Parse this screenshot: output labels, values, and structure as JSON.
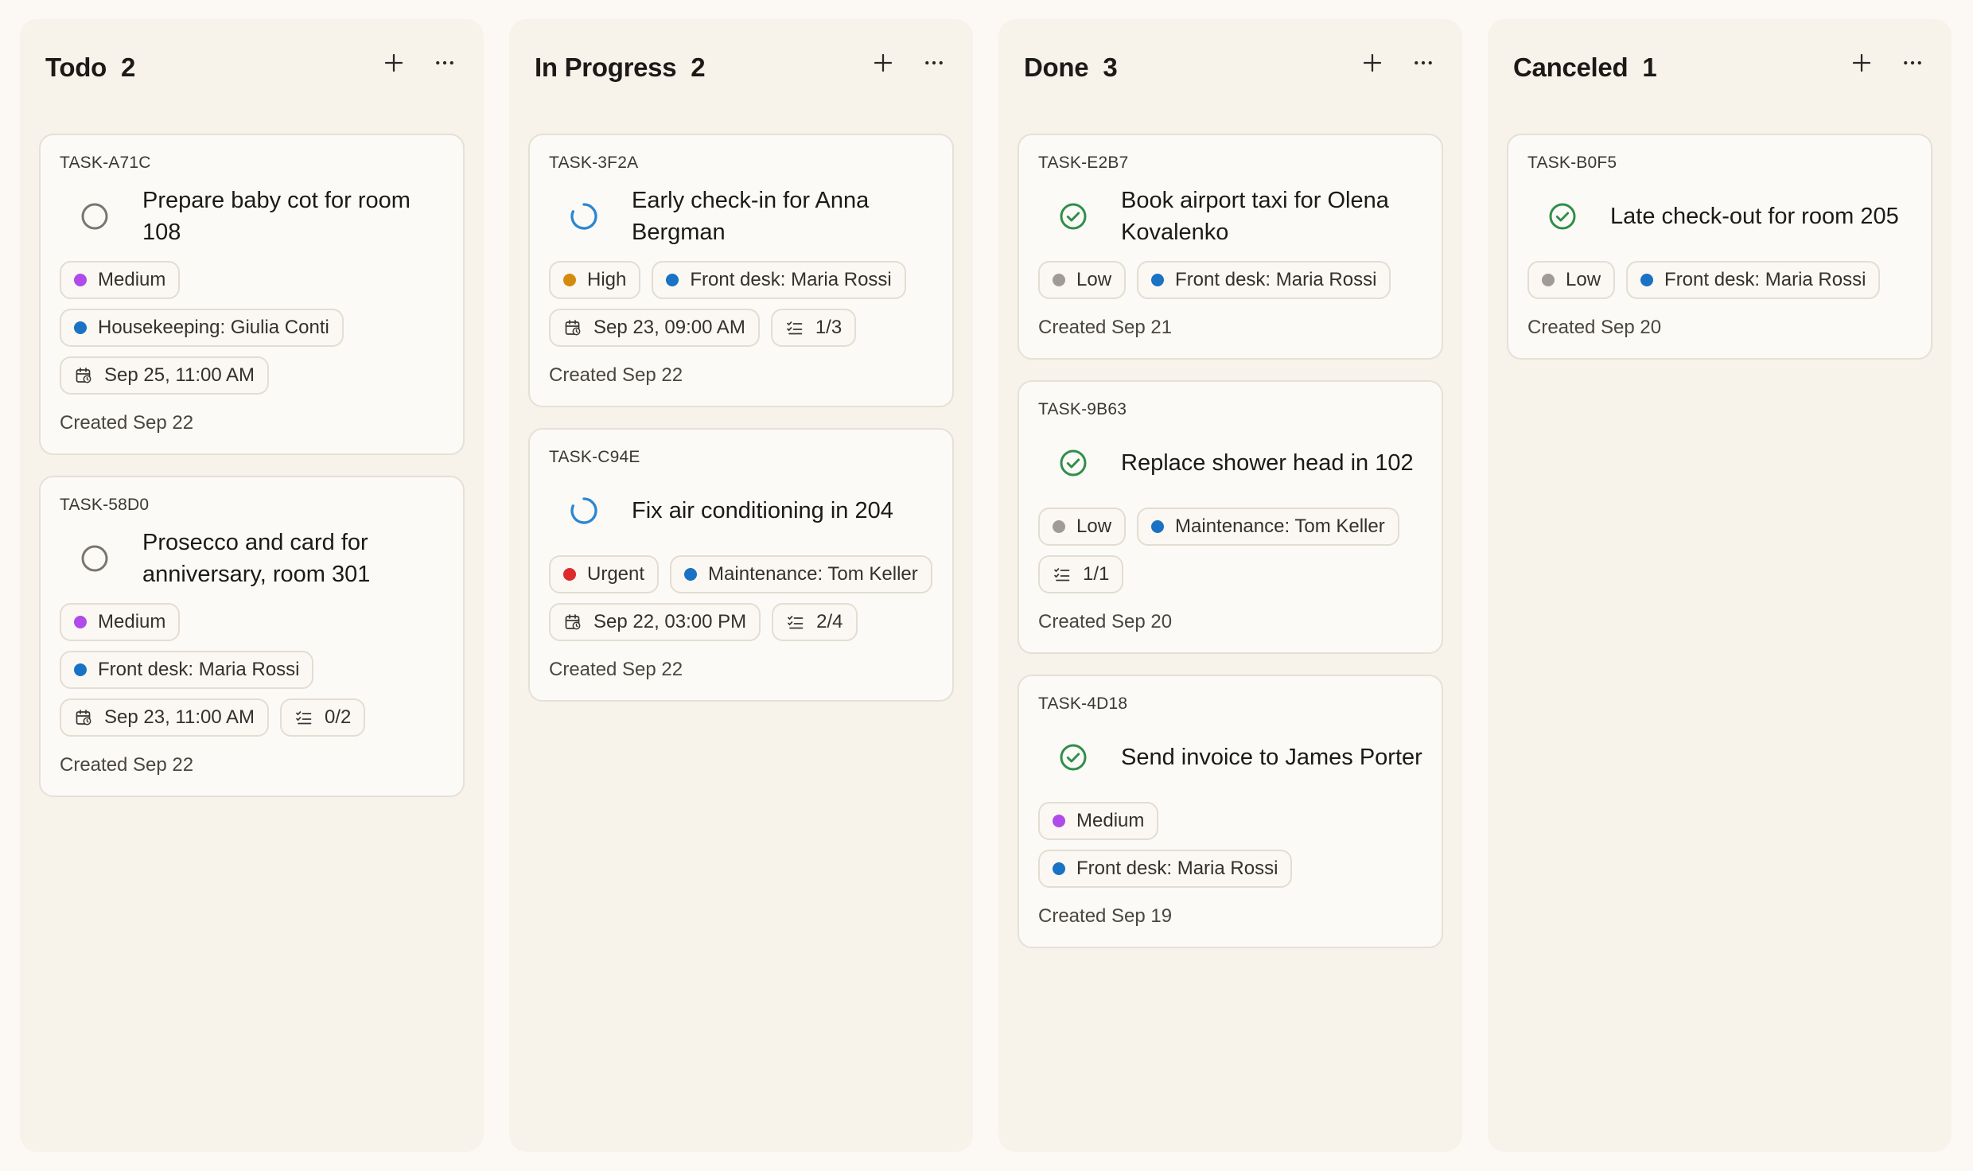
{
  "colors": {
    "medium": "#b04ae8",
    "high": "#d58a0d",
    "urgent": "#dc2b2b",
    "low": "#a09c95",
    "assignee": "#1a72c4",
    "done_icon": "#2f8f4a",
    "progress_icon": "#2c86cf",
    "todo_icon": "#7a766f"
  },
  "columns": [
    {
      "title": "Todo",
      "count": "2",
      "cards": [
        {
          "id": "TASK-A71C",
          "status": "todo",
          "title": "Prepare baby cot for room 108",
          "chips": [
            {
              "kind": "priority",
              "color": "medium",
              "label": "Medium"
            },
            {
              "kind": "assignee",
              "color": "assignee",
              "label": "Housekeeping: Giulia Conti"
            },
            {
              "kind": "date",
              "label": "Sep 25, 11:00 AM"
            }
          ],
          "created": "Created Sep 22"
        },
        {
          "id": "TASK-58D0",
          "status": "todo",
          "title": "Prosecco and card for anniversary, room 301",
          "chips": [
            {
              "kind": "priority",
              "color": "medium",
              "label": "Medium"
            },
            {
              "kind": "assignee",
              "color": "assignee",
              "label": "Front desk: Maria Rossi"
            },
            {
              "kind": "date",
              "label": "Sep 23, 11:00 AM"
            },
            {
              "kind": "subtasks",
              "label": "0/2"
            }
          ],
          "created": "Created Sep 22"
        }
      ]
    },
    {
      "title": "In Progress",
      "count": "2",
      "cards": [
        {
          "id": "TASK-3F2A",
          "status": "progress",
          "title": "Early check-in for Anna Bergman",
          "chips": [
            {
              "kind": "priority",
              "color": "high",
              "label": "High"
            },
            {
              "kind": "assignee",
              "color": "assignee",
              "label": "Front desk: Maria Rossi"
            },
            {
              "kind": "date",
              "label": "Sep 23, 09:00 AM"
            },
            {
              "kind": "subtasks",
              "label": "1/3"
            }
          ],
          "created": "Created Sep 22"
        },
        {
          "id": "TASK-C94E",
          "status": "progress",
          "title": "Fix air conditioning in 204",
          "chips": [
            {
              "kind": "priority",
              "color": "urgent",
              "label": "Urgent"
            },
            {
              "kind": "assignee",
              "color": "assignee",
              "label": "Maintenance: Tom Keller"
            },
            {
              "kind": "date",
              "label": "Sep 22, 03:00 PM"
            },
            {
              "kind": "subtasks",
              "label": "2/4"
            }
          ],
          "created": "Created Sep 22"
        }
      ]
    },
    {
      "title": "Done",
      "count": "3",
      "cards": [
        {
          "id": "TASK-E2B7",
          "status": "done",
          "title": "Book airport taxi for Olena Kovalenko",
          "chips": [
            {
              "kind": "priority",
              "color": "low",
              "label": "Low"
            },
            {
              "kind": "assignee",
              "color": "assignee",
              "label": "Front desk: Maria Rossi"
            }
          ],
          "created": "Created Sep 21"
        },
        {
          "id": "TASK-9B63",
          "status": "done",
          "title": "Replace shower head in 102",
          "chips": [
            {
              "kind": "priority",
              "color": "low",
              "label": "Low"
            },
            {
              "kind": "assignee",
              "color": "assignee",
              "label": "Maintenance: Tom Keller"
            },
            {
              "kind": "subtasks",
              "label": "1/1"
            }
          ],
          "created": "Created Sep 20"
        },
        {
          "id": "TASK-4D18",
          "status": "done",
          "title": "Send invoice to James Porter",
          "chips": [
            {
              "kind": "priority",
              "color": "medium",
              "label": "Medium"
            },
            {
              "kind": "assignee",
              "color": "assignee",
              "label": "Front desk: Maria Rossi"
            }
          ],
          "created": "Created Sep 19"
        }
      ]
    },
    {
      "title": "Canceled",
      "count": "1",
      "cards": [
        {
          "id": "TASK-B0F5",
          "status": "done",
          "title": "Late check-out for room 205",
          "chips": [
            {
              "kind": "priority",
              "color": "low",
              "label": "Low"
            },
            {
              "kind": "assignee",
              "color": "assignee",
              "label": "Front desk: Maria Rossi"
            }
          ],
          "created": "Created Sep 20"
        }
      ]
    }
  ],
  "icons": {
    "add": "plus-icon",
    "more": "more-horizontal-icon",
    "date": "calendar-clock-icon",
    "subtasks": "checklist-icon",
    "todo": "circle-outline-icon",
    "progress": "in-progress-spinner-icon",
    "done": "check-circle-icon"
  }
}
